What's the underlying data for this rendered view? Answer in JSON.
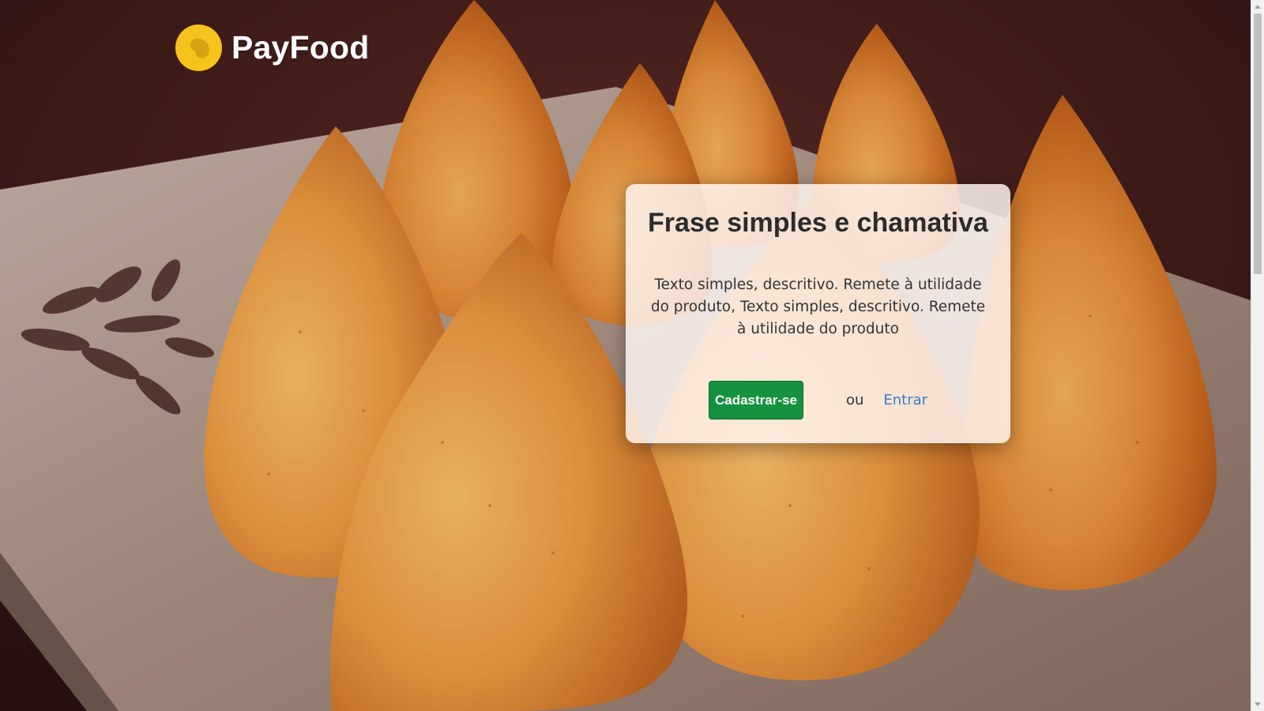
{
  "header": {
    "brand_name": "PayFood",
    "logo_icon": "coxinha-logo-icon",
    "logo_color": "#f6c21c"
  },
  "hero": {
    "title": "Frase simples e chamativa",
    "description": "Texto simples, descritivo. Remete à utilidade do produto, Texto simples, descritivo. Remete à utilidade do produto",
    "signup_label": "Cadastrar-se",
    "or_text": "ou",
    "login_label": "Entrar"
  },
  "colors": {
    "signup_button": "#16913f",
    "login_link": "#3a7bc8",
    "card_background": "#fff5f2"
  }
}
